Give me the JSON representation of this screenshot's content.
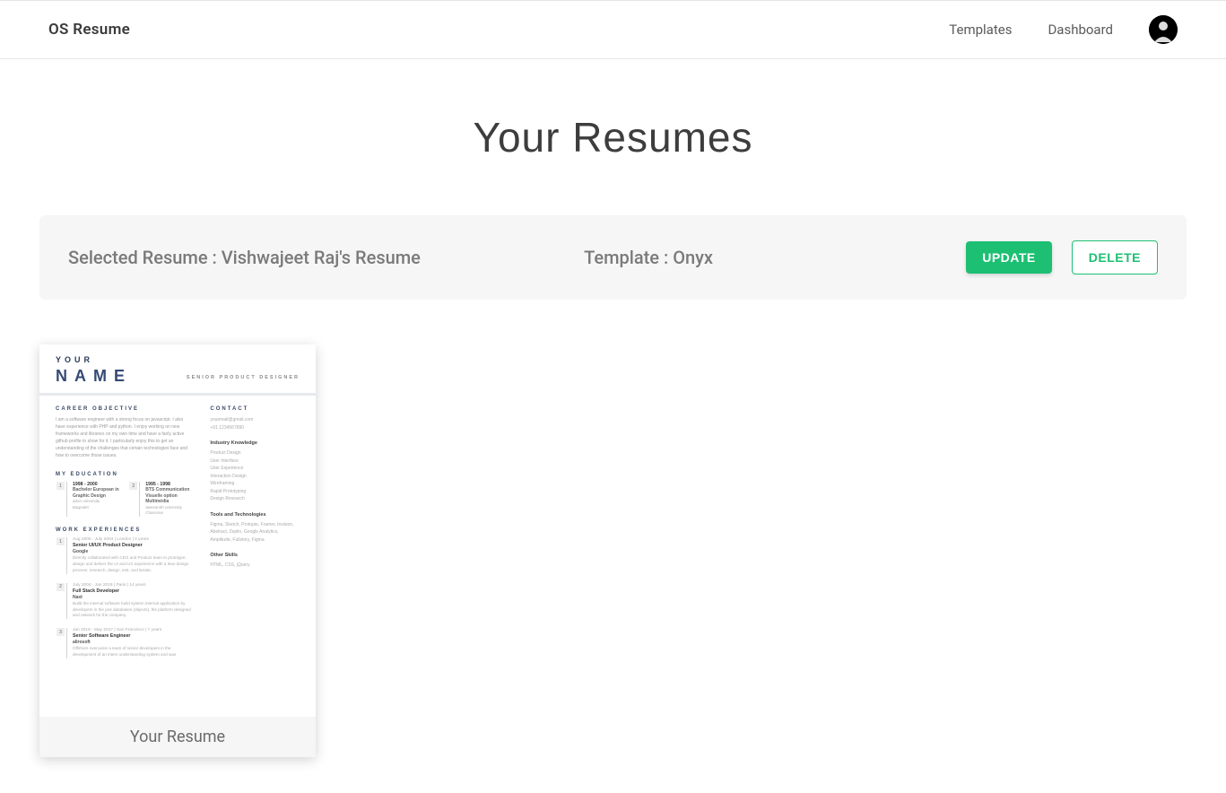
{
  "header": {
    "brand": "OS Resume",
    "nav": {
      "templates": "Templates",
      "dashboard": "Dashboard"
    }
  },
  "page": {
    "title": "Your Resumes",
    "selected_label": "Selected Resume : Vishwajeet Raj's Resume",
    "template_label": "Template : Onyx",
    "buttons": {
      "update": "UPDATE",
      "delete": "DELETE"
    }
  },
  "card": {
    "label": "Your Resume"
  },
  "thumb": {
    "your": "YOUR",
    "name": "NAME",
    "role": "SENIOR PRODUCT DESIGNER",
    "sections": {
      "objective_h": "CAREER OBJECTIVE",
      "objective_body": "I am a software engineer with a strong focus on javascript. I also have experience with PHP and python. I enjoy working on new frameworks and libraries on my own time and have a fairly active github profile to show for it. I particularly enjoy this to get an understanding of the challenges that certain technologies face and how to overcome those issues.",
      "education_h": "MY EDUCATION",
      "ed1": {
        "num": "1",
        "years": "1998 - 2000",
        "deg": "Bachelor European in Graphic Design",
        "school": "adon university",
        "loc": "Bagnalet"
      },
      "ed2": {
        "num": "2",
        "years": "1995 - 1998",
        "deg": "BTS Communication Visuelle option Multimédia",
        "school": "awesomth university",
        "loc": "Charonne"
      },
      "work_h": "WORK EXPERIENCES",
      "exp1": {
        "num": "1",
        "date": "Aug 2000 - July 2004 | London | 4 years",
        "title": "Senior UI/UX Product Designer",
        "company": "Google",
        "body": "Directly collaborated with CEO and Product team to prototype, design and deliver the UI and UX experience with a lean design process: research, design, test, and iterate."
      },
      "exp2": {
        "num": "2",
        "date": "July 2004 - Jan 2018 | Paris | 14 years",
        "title": "Full Stack Developer",
        "company": "Naxt",
        "body": "Build the internal software build system internal application by developers in the pos databases (objects), the platform designed and network for the company."
      },
      "exp3": {
        "num": "3",
        "date": "Jan 2018 - May 2017 | San Francisco | 7 years",
        "title": "Senior Software Engineer",
        "company": "alirosoft",
        "body": "Offshore overcame a team of senior developers in the development of an intern understanding system and was"
      },
      "contact_h": "CONTACT",
      "contact_body": "youemail@gmail.com\n+91 1234567890",
      "ik_h": "Industry Knowledge",
      "ik_body": "Product Design\nUser Interface\nUser Experience\nInteraction Design\nWireframing\nRapid Prototyping\nDesign Research",
      "tt_h": "Tools and Technologies",
      "tt_body": "Figma, Sketch, Protopie, Framer, Invision, Abstract, Zeplin, Google Analytics, Amplitude, Fullstory, Figma",
      "os_h": "Other Skills",
      "os_body": "HTML, CSS, jQuery"
    }
  }
}
